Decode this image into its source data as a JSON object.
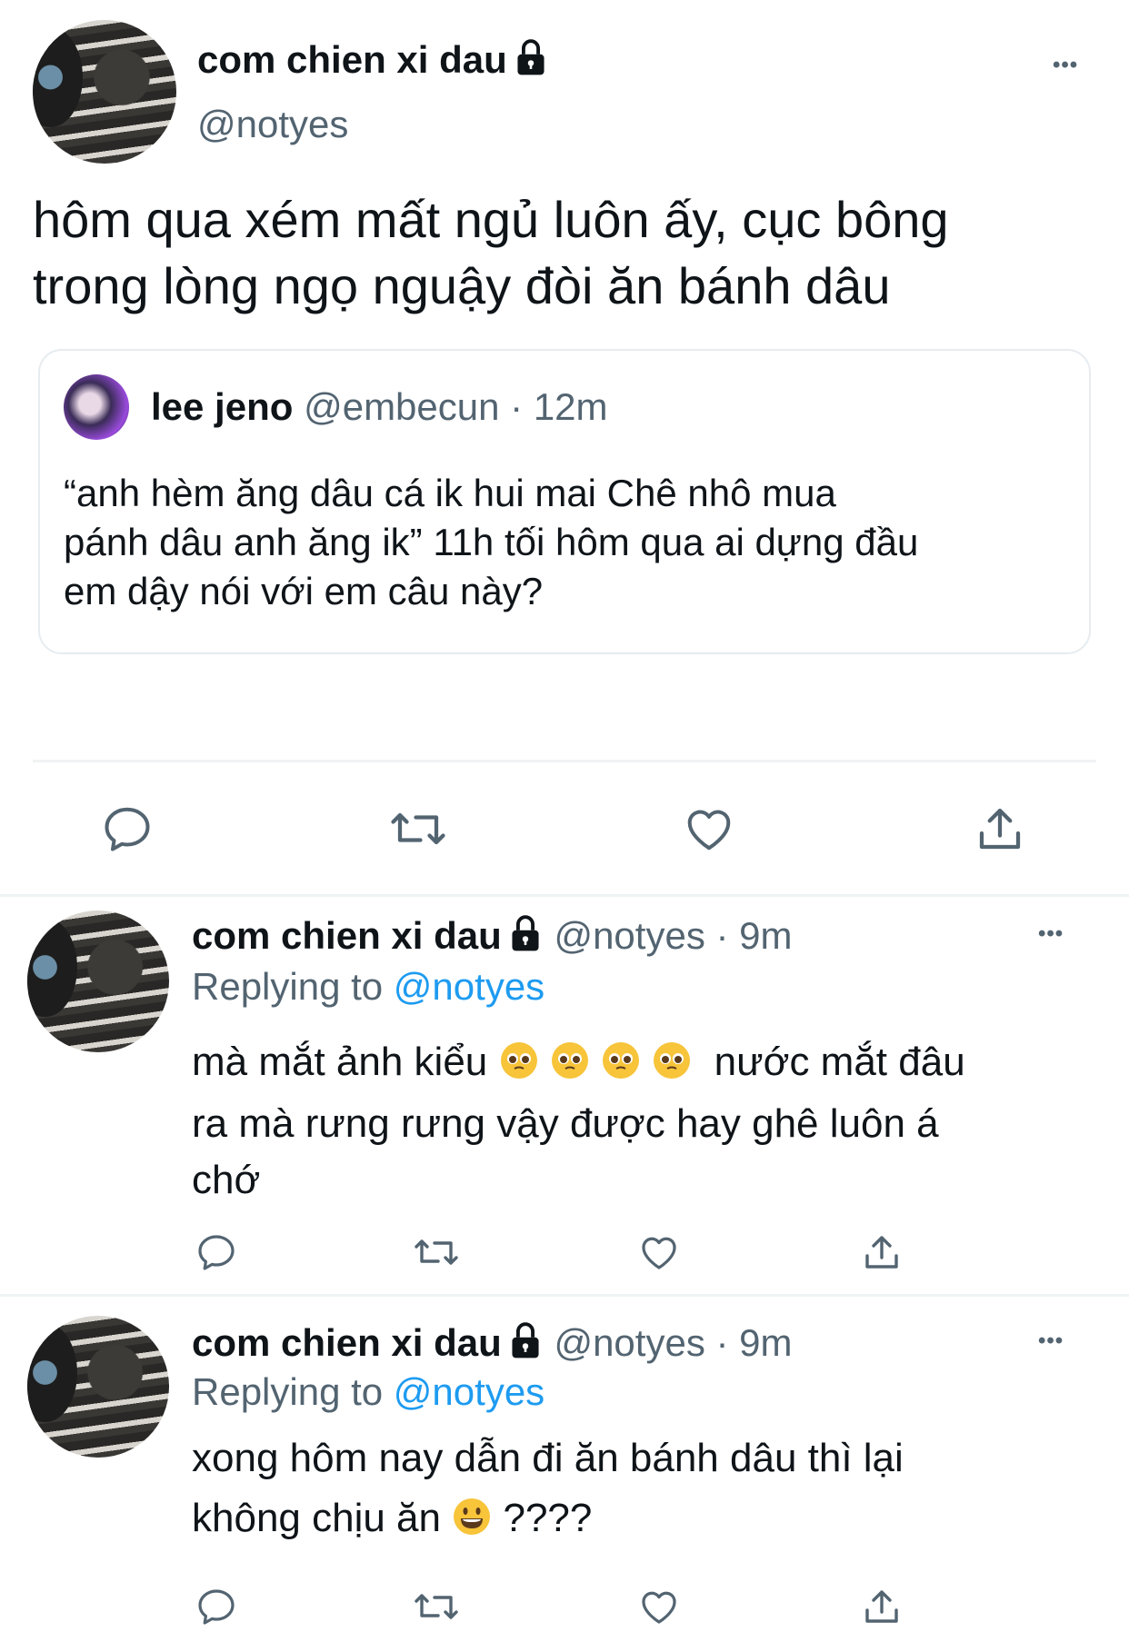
{
  "main_tweet": {
    "display_name": "com chien xi dau",
    "handle": "@notyes",
    "text": "hôm qua xém mất ngủ luôn ấy, cục bông\ntrong lòng ngọ nguậy đòi ăn bánh dâu",
    "more_label": "•••",
    "quote": {
      "display_name": "lee jeno",
      "handle": "@embecun",
      "time": "· 12m",
      "text": "“anh hèm ăng dâu cá ik hui mai Chê nhô mua\npánh dâu anh ăng ik” 11h tối hôm qua ai dựng đầu\nem dậy nói với em câu này?"
    }
  },
  "replies": [
    {
      "display_name": "com chien xi dau",
      "handle": "@notyes",
      "time": "· 9m",
      "replying_label": "Replying to",
      "replying_to": "@notyes",
      "text_before": "mà mắt ảnh kiểu",
      "text_after": "nước mắt đâu\nra mà rưng rưng vậy được hay ghê luôn á\nchớ",
      "more_label": "•••"
    },
    {
      "display_name": "com chien xi dau",
      "handle": "@notyes",
      "time": "· 9m",
      "replying_label": "Replying to",
      "replying_to": "@notyes",
      "text_before": "xong hôm nay dẫn đi ăn bánh dâu thì lại\nkhông chịu ăn",
      "text_after": "????",
      "more_label": "•••"
    }
  ],
  "colors": {
    "accent": "#1d9bf0",
    "muted": "#536471",
    "text": "#0f1419"
  }
}
